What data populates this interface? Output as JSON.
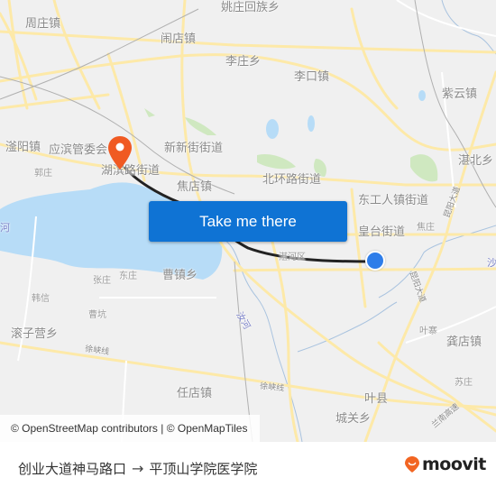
{
  "map": {
    "labels": {
      "zhouzhuang": "周庄镇",
      "yaozhuang": "姚庄回族乡",
      "chuandian": "闹店镇",
      "lizhuang": "李庄乡",
      "likou": "李口镇",
      "ziyun": "紫云镇",
      "zhanbei": "湛北乡",
      "yiyang": "滏阳镇",
      "yingbin": "应滨管委会",
      "xinxin": "新新街街道",
      "hubin": "湖滨路街道",
      "guozhuang": "郭庄",
      "jiaodian": "焦店镇",
      "beihuan": "北环路街道",
      "donggongren": "东工人镇街道",
      "huangtai": "皇台街道",
      "jiaozhuang": "焦庄",
      "zhanhe": "湛河区",
      "kunyang_1": "昆阳大道",
      "kunyang_2": "昆阳大道",
      "sha_river": "沙",
      "he_left": "河",
      "dongzhuang": "东庄",
      "zhangzhuang": "张庄",
      "caozhen": "曹镇乡",
      "hanxin": "韩信",
      "caokeng": "曹坑",
      "gunzi": "滚子营乡",
      "xujia_1": "徐峡线",
      "xujia_2": "徐峡线",
      "ru_river": "汝河",
      "yezhai": "叶寨",
      "gongdian": "龚店镇",
      "suzhuang": "苏庄",
      "rendian": "任店镇",
      "yexian": "叶县",
      "chengguan": "城关乡",
      "lannan": "兰南高速"
    },
    "cta_label": "Take me there",
    "attribution": "© OpenStreetMap contributors | © OpenMapTiles",
    "colors": {
      "land": "#f0f0f0",
      "water": "#b7dcf7",
      "road": "#fde9a8",
      "park": "#cfe8c0",
      "route": "#222222",
      "origin": "#2e7de9",
      "destination": "#f05a22",
      "cta": "#0f73d4"
    }
  },
  "footer": {
    "origin": "创业大道神马路口",
    "arrow": "→",
    "destination": "平顶山学院医学院",
    "brand": "moovit",
    "brand_color": "#f26522"
  }
}
